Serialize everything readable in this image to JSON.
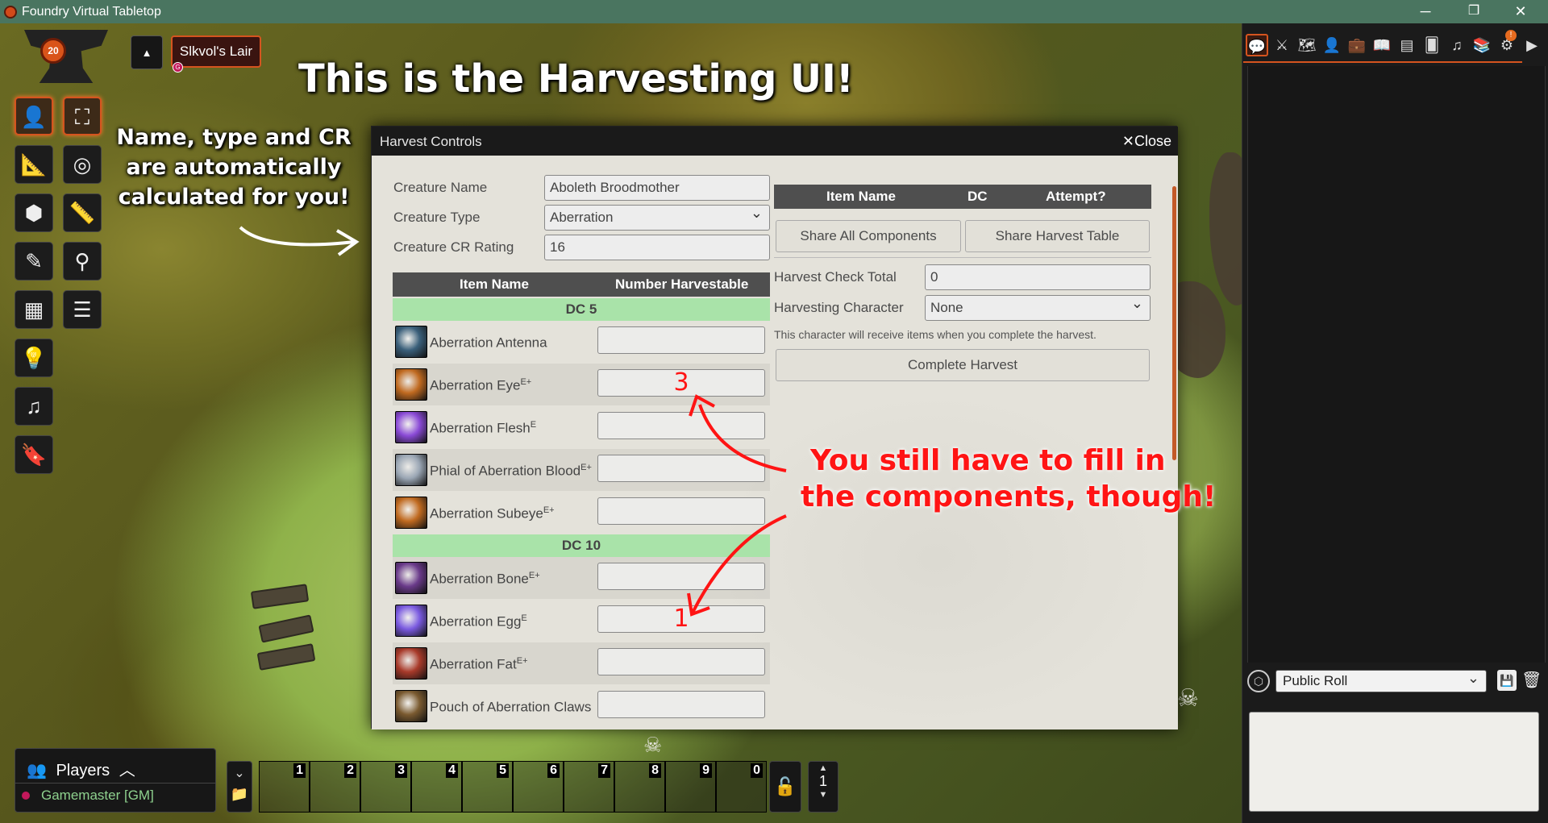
{
  "window": {
    "title": "Foundry Virtual Tabletop",
    "minimize": "─",
    "restore": "❐",
    "close": "✕"
  },
  "scene": {
    "name": "Slkvol's Lair",
    "gm_badge": "G"
  },
  "annotations": {
    "title": "This is the Harvesting UI!",
    "auto_line1": "Name, type and CR",
    "auto_line2": "are automatically",
    "auto_line3": "calculated for you!",
    "fill_line1": "You still have to fill in",
    "fill_line2": "the components, though!"
  },
  "dialog": {
    "title": "Harvest Controls",
    "close_label": "Close",
    "fields": {
      "name_label": "Creature Name",
      "name_value": "Aboleth Broodmother",
      "type_label": "Creature Type",
      "type_value": "Aberration",
      "cr_label": "Creature CR Rating",
      "cr_value": "16"
    },
    "components_table": {
      "col_item": "Item Name",
      "col_count": "Number Harvestable",
      "groups": [
        {
          "dc": "DC 5",
          "items": [
            {
              "name": "Aberration Antenna",
              "sup": "",
              "value": "",
              "icon": "antenna-icon",
              "color": "#3a5f7a"
            },
            {
              "name": "Aberration Eye",
              "sup": "E+",
              "value": "3",
              "icon": "eye-icon",
              "color": "#c06a20"
            },
            {
              "name": "Aberration Flesh",
              "sup": "E",
              "value": "",
              "icon": "flesh-icon",
              "color": "#8a4ad6"
            },
            {
              "name": "Phial of Aberration Blood",
              "sup": "E+",
              "value": "",
              "icon": "phial-icon",
              "color": "#9aa6b4"
            },
            {
              "name": "Aberration Subeye",
              "sup": "E+",
              "value": "",
              "icon": "subeye-icon",
              "color": "#c06a20"
            }
          ]
        },
        {
          "dc": "DC 10",
          "items": [
            {
              "name": "Aberration Bone",
              "sup": "E+",
              "value": "",
              "icon": "bone-icon",
              "color": "#6a3a8a"
            },
            {
              "name": "Aberration Egg",
              "sup": "E",
              "value": "1",
              "icon": "egg-icon",
              "color": "#7a5ae0"
            },
            {
              "name": "Aberration Fat",
              "sup": "E+",
              "value": "",
              "icon": "fat-icon",
              "color": "#a83a2a"
            },
            {
              "name": "Pouch of Aberration Claws",
              "sup": "",
              "value": "",
              "icon": "pouch-icon",
              "color": "#7a5a30"
            }
          ]
        }
      ]
    },
    "attempt_table": {
      "col_item": "Item Name",
      "col_dc": "DC",
      "col_attempt": "Attempt?"
    },
    "share_all": "Share All Components",
    "share_table": "Share Harvest Table",
    "check_label": "Harvest Check Total",
    "check_value": "0",
    "character_label": "Harvesting Character",
    "character_value": "None",
    "hint": "This character will receive items when you complete the harvest.",
    "complete": "Complete Harvest"
  },
  "sidebar": {
    "tabs": [
      "chat-icon",
      "combat-icon",
      "scenes-icon",
      "actors-icon",
      "items-icon",
      "journal-icon",
      "tables-icon",
      "cards-icon",
      "playlists-icon",
      "compendium-icon",
      "settings-icon",
      "collapse-icon"
    ],
    "notification": "!",
    "roll_mode": "Public Roll"
  },
  "players": {
    "title": "Players",
    "user": "Gamemaster [GM]",
    "user_color": "#c2185b"
  },
  "hotbar": {
    "slots": [
      "1",
      "2",
      "3",
      "4",
      "5",
      "6",
      "7",
      "8",
      "9",
      "0"
    ],
    "page": "1"
  }
}
